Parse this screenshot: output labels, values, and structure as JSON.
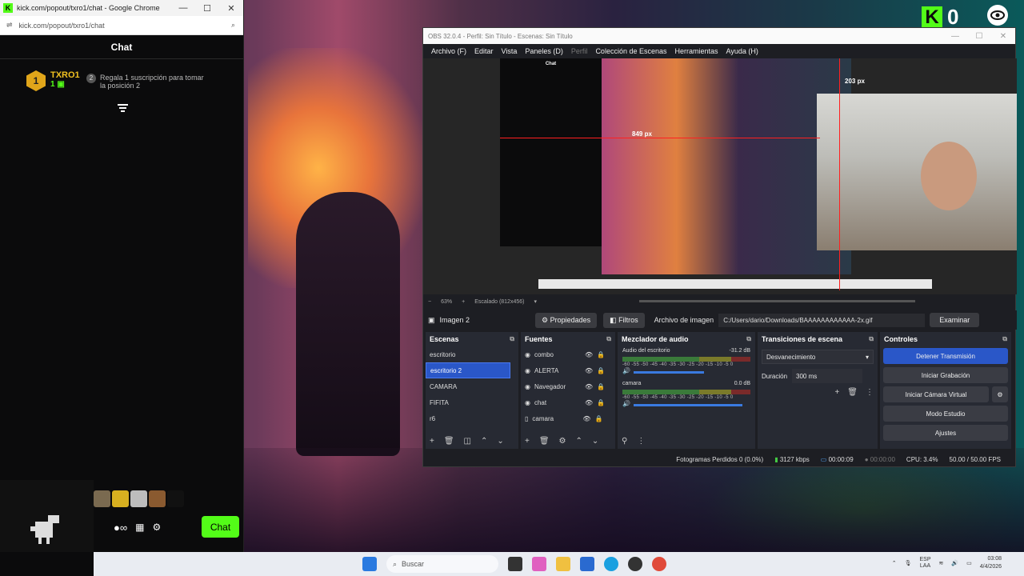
{
  "chrome": {
    "title": "kick.com/popout/txro1/chat - Google Chrome",
    "url": "kick.com/popout/txro1/chat",
    "min": "—",
    "max": "☐",
    "close": "✕"
  },
  "chat": {
    "header": "Chat",
    "leader_rank": "1",
    "leader_name": "TXRO1",
    "leader_count": "1",
    "gift_rank": "2",
    "gift_text": "Regala 1 suscripción para tomar la posición 2",
    "send_label": "Chat"
  },
  "overlay": {
    "kick_letter": "K",
    "viewer_count": "0"
  },
  "obs": {
    "title": "OBS 32.0.4 - Perfil: Sin Título - Escenas: Sin Título",
    "menu": [
      "Archivo (F)",
      "Editar",
      "Vista",
      "Paneles (D)",
      "Perfil",
      "Colección de Escenas",
      "Herramientas",
      "Ayuda (H)"
    ],
    "preview": {
      "chat_title": "Chat",
      "label_849": "849 px",
      "label_203": "203 px"
    },
    "zoom": {
      "minus": "−",
      "percent": "63%",
      "plus": "+",
      "scaled": "Escalado (812x456)"
    },
    "source_bar": {
      "selected": "Imagen 2",
      "properties": "Propiedades",
      "filters": "Filtros",
      "file_label": "Archivo de imagen",
      "path": "C:/Users/dario/Downloads/BAAAAAAAAAAAA-2x.gif",
      "browse": "Examinar"
    },
    "scenes": {
      "title": "Escenas",
      "items": [
        "escritorio",
        "escritorio 2",
        "CAMARA",
        "FIFITA",
        "r6"
      ]
    },
    "sources": {
      "title": "Fuentes",
      "items": [
        "combo",
        "ALERTA",
        "Navegador",
        "chat",
        "camara"
      ]
    },
    "mixer": {
      "title": "Mezclador de audio",
      "ch1_name": "Audio del escritorio",
      "ch1_db": "-31.2 dB",
      "ch2_name": "camara",
      "ch2_db": "0.0 dB",
      "scale": "-60 -55 -50 -45 -40 -35 -30 -25 -20 -15 -10 -5 0"
    },
    "transitions": {
      "title": "Transiciones de escena",
      "type": "Desvanecimiento",
      "duration_label": "Duración",
      "duration": "300 ms"
    },
    "controls": {
      "title": "Controles",
      "stop": "Detener Transmisión",
      "record": "Iniciar Grabación",
      "virtual_cam": "Iniciar Cámara Virtual",
      "studio": "Modo Estudio",
      "settings": "Ajustes"
    },
    "status": {
      "frames": "Fotogramas Perdidos 0 (0.0%)",
      "bitrate": "3127 kbps",
      "stream_time": "00:00:09",
      "rec_time": "00:00:00",
      "cpu": "CPU: 3.4%",
      "fps": "50.00 / 50.00 FPS"
    }
  },
  "taskbar": {
    "search": "Buscar",
    "lang1": "ESP",
    "lang2": "LAA",
    "time": "03:08",
    "date": "4/4/2026"
  },
  "colors": {
    "kick_green": "#53fc18",
    "obs_accent": "#2a57c8"
  }
}
